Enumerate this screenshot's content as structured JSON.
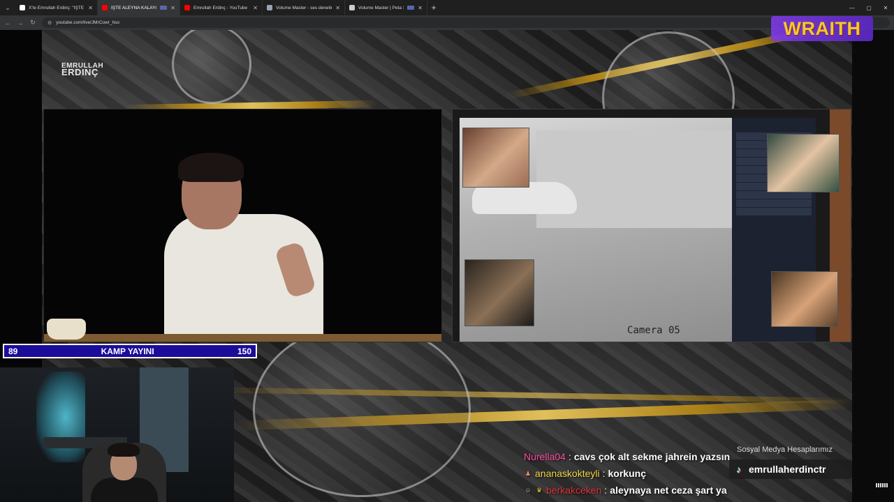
{
  "browser": {
    "tabs": [
      {
        "title": "X'te Emrullah Erdinç: \"İŞTE ALEY",
        "favicon_color": "#ffffff",
        "active": false,
        "has_badge": false
      },
      {
        "title": "İŞTE ALEYNA KALAYCIOĞLU",
        "favicon_color": "#ff0000",
        "active": true,
        "has_badge": true
      },
      {
        "title": "Emrullah Erdinç - YouTube",
        "favicon_color": "#ff0000",
        "active": false,
        "has_badge": false
      },
      {
        "title": "Volume Master - ses denetleyici",
        "favicon_color": "#9aa3b5",
        "active": false,
        "has_badge": false
      },
      {
        "title": "Volume Master | Peta Sittek",
        "favicon_color": "#cccccc",
        "active": false,
        "has_badge": true
      }
    ],
    "url": "youtube.com/live/JMrCowr_hso"
  },
  "overlay": {
    "brand_logo_line1": "EMRULLAH",
    "brand_logo_line2": "ERDINÇ",
    "sponsor_logo": "WRAITH",
    "cctv_caption": "Camera 05",
    "ticker": {
      "left_value": "89",
      "title": "KAMP YAYINI",
      "right_value": "150"
    },
    "social": {
      "label": "Sosyal Medya Hesaplarımız",
      "handle": "emrullaherdinctr"
    }
  },
  "chat": [
    {
      "user": "Nurella04",
      "user_color": "#ff4fa3",
      "message": "cavs çok alt sekme jahrein yazsın",
      "badges": []
    },
    {
      "user": "ananaskokteyli",
      "user_color": "#f0d84a",
      "message": "korkunç",
      "badges": [
        "person-badge"
      ]
    },
    {
      "user": "berkakceken",
      "user_color": "#e0343a",
      "message": "aleynaya net ceza şart ya",
      "badges": [
        "smile-badge",
        "crown-badge"
      ]
    }
  ],
  "colors": {
    "ticker_bg": "#1b0d9a",
    "wraith_gold": "#f6c531",
    "wraith_purple": "#7e3ae6"
  }
}
